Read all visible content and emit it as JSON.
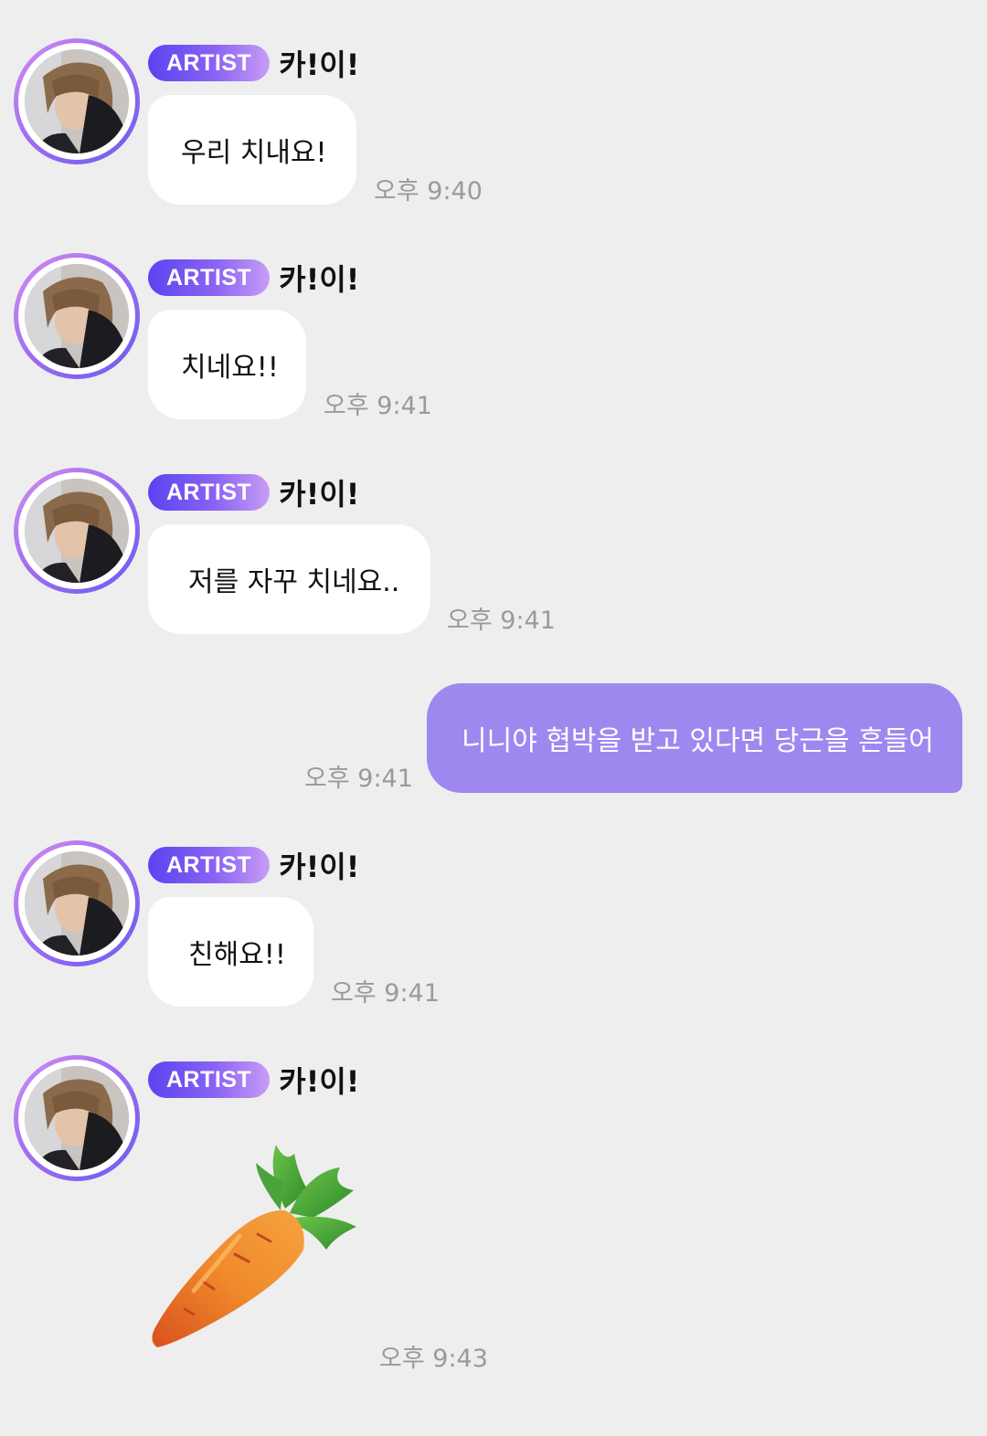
{
  "artist_badge": "ARTIST",
  "sender_name": "카!이!",
  "messages": [
    {
      "type": "in",
      "text": "우리 치내요!",
      "time": "오후 9:40"
    },
    {
      "type": "in",
      "text": "치네요!!",
      "time": "오후 9:41"
    },
    {
      "type": "in",
      "text": "저를 자꾸 치네요..",
      "time": "오후 9:41"
    },
    {
      "type": "out",
      "text": "니니야 협박을 받고 있다면 당근을 흔들어",
      "time": "오후 9:41"
    },
    {
      "type": "in",
      "text": "친해요!!",
      "time": "오후 9:41"
    },
    {
      "type": "in-sticker",
      "sticker": "carrot-emoji",
      "time": "오후 9:43"
    }
  ],
  "colors": {
    "background": "#eeeeef",
    "outgoing_bubble": "#9e88ef",
    "incoming_bubble": "#ffffff",
    "timestamp": "#9a9a9a",
    "badge_start": "#5a43f0",
    "badge_end": "#c79cf5"
  }
}
